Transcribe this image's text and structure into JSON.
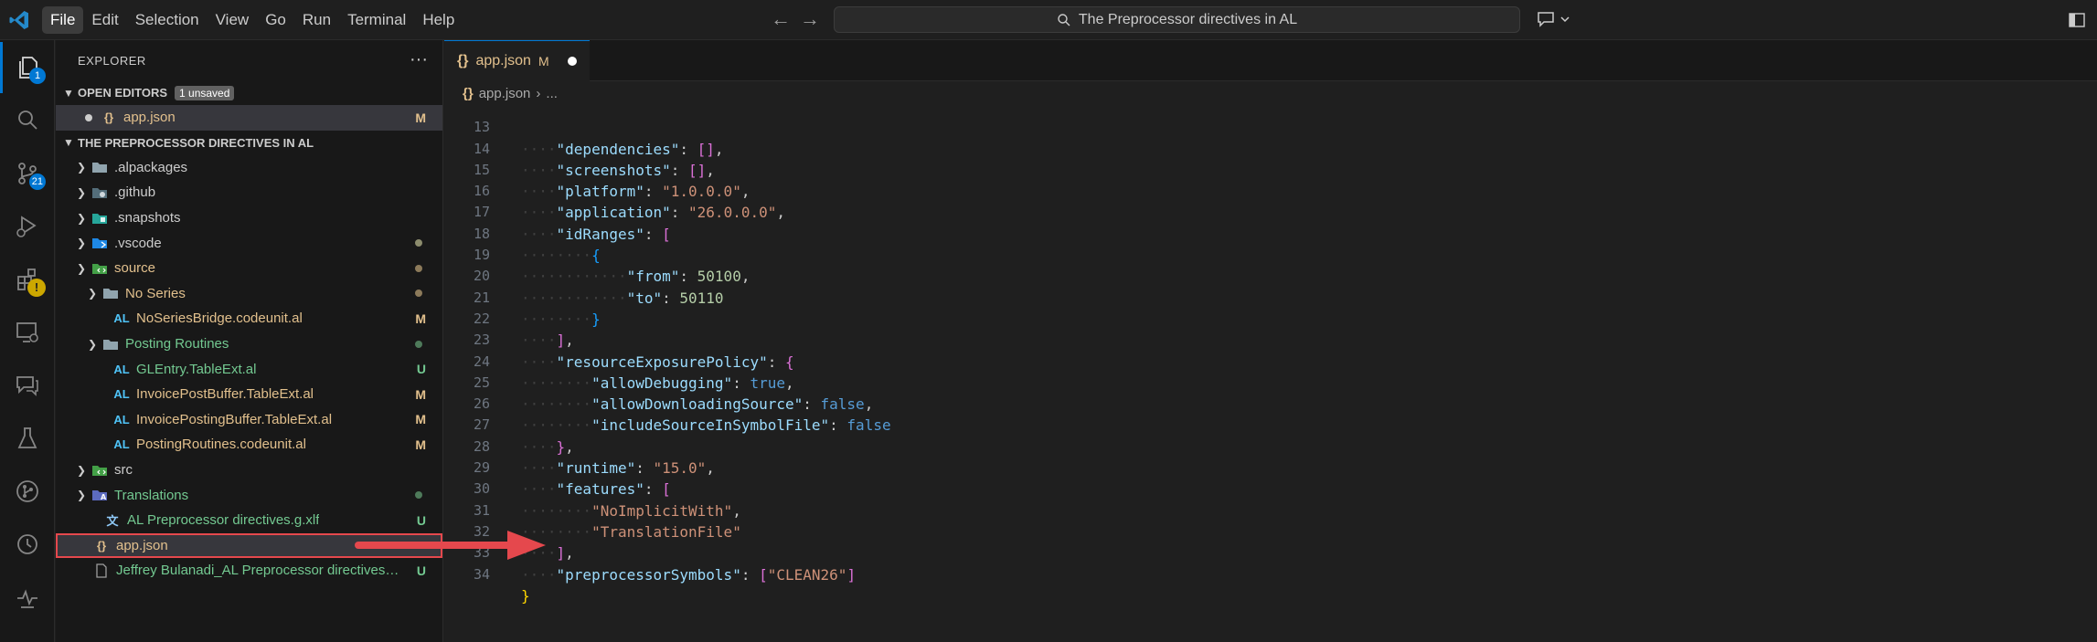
{
  "titlebar": {
    "menu": [
      "File",
      "Edit",
      "Selection",
      "View",
      "Go",
      "Run",
      "Terminal",
      "Help"
    ],
    "active_menu": "File",
    "search_text": "The Preprocessor directives in AL"
  },
  "activity": {
    "explorer_badge": "1",
    "scm_badge": "21",
    "extensions_warning": "!"
  },
  "sidebar": {
    "title": "EXPLORER",
    "more_actions": "···",
    "open_editors": {
      "label": "OPEN EDITORS",
      "badge": "1 unsaved",
      "items": [
        {
          "name": "app.json",
          "deco": "M"
        }
      ]
    },
    "workspace": {
      "label": "THE PREPROCESSOR DIRECTIVES IN AL",
      "rows": [
        {
          "name": ".alpackages",
          "deco": ""
        },
        {
          "name": ".github",
          "deco": ""
        },
        {
          "name": ".snapshots",
          "deco": ""
        },
        {
          "name": ".vscode",
          "deco": ""
        },
        {
          "name": "source",
          "deco": ""
        },
        {
          "name": "No Series",
          "deco": ""
        },
        {
          "name": "NoSeriesBridge.codeunit.al",
          "deco": "M",
          "icon": "AL"
        },
        {
          "name": "Posting Routines",
          "deco": ""
        },
        {
          "name": "GLEntry.TableExt.al",
          "deco": "U",
          "icon": "AL"
        },
        {
          "name": "InvoicePostBuffer.TableExt.al",
          "deco": "M",
          "icon": "AL"
        },
        {
          "name": "InvoicePostingBuffer.TableExt.al",
          "deco": "M",
          "icon": "AL"
        },
        {
          "name": "PostingRoutines.codeunit.al",
          "deco": "M",
          "icon": "AL"
        },
        {
          "name": "src",
          "deco": ""
        },
        {
          "name": "Translations",
          "deco": ""
        },
        {
          "name": "AL Preprocessor directives.g.xlf",
          "deco": "U"
        },
        {
          "name": "app.json",
          "deco": ""
        },
        {
          "name": "Jeffrey Bulanadi_AL Preprocessor directives in AL...",
          "deco": "U"
        }
      ]
    }
  },
  "editor": {
    "tab": {
      "name": "app.json",
      "deco": "M"
    },
    "breadcrumb": [
      "app.json",
      "..."
    ],
    "line_numbers": [
      "13",
      "14",
      "15",
      "16",
      "17",
      "18",
      "19",
      "20",
      "21",
      "22",
      "23",
      "24",
      "25",
      "26",
      "27",
      "28",
      "29",
      "30",
      "31",
      "32",
      "33",
      "34"
    ],
    "code": {
      "l13_key": "\"dependencies\"",
      "l14_key": "\"screenshots\"",
      "l15_key": "\"platform\"",
      "l15_val": "\"1.0.0.0\"",
      "l16_key": "\"application\"",
      "l16_val": "\"26.0.0.0\"",
      "l17_key": "\"idRanges\"",
      "l19_key": "\"from\"",
      "l19_val": "50100",
      "l20_key": "\"to\"",
      "l20_val": "50110",
      "l23_key": "\"resourceExposurePolicy\"",
      "l24_key": "\"allowDebugging\"",
      "l24_val": "true",
      "l25_key": "\"allowDownloadingSource\"",
      "l25_val": "false",
      "l26_key": "\"includeSourceInSymbolFile\"",
      "l26_val": "false",
      "l28_key": "\"runtime\"",
      "l28_val": "\"15.0\"",
      "l29_key": "\"features\"",
      "l30_val": "\"NoImplicitWith\"",
      "l31_val": "\"TranslationFile\"",
      "l33_key": "\"preprocessorSymbols\"",
      "l33_val": "\"CLEAN26\""
    }
  },
  "colors": {
    "accent": "#0078d4",
    "annotation": "#e5484d",
    "modified": "#e2c08d",
    "untracked": "#73c991"
  }
}
